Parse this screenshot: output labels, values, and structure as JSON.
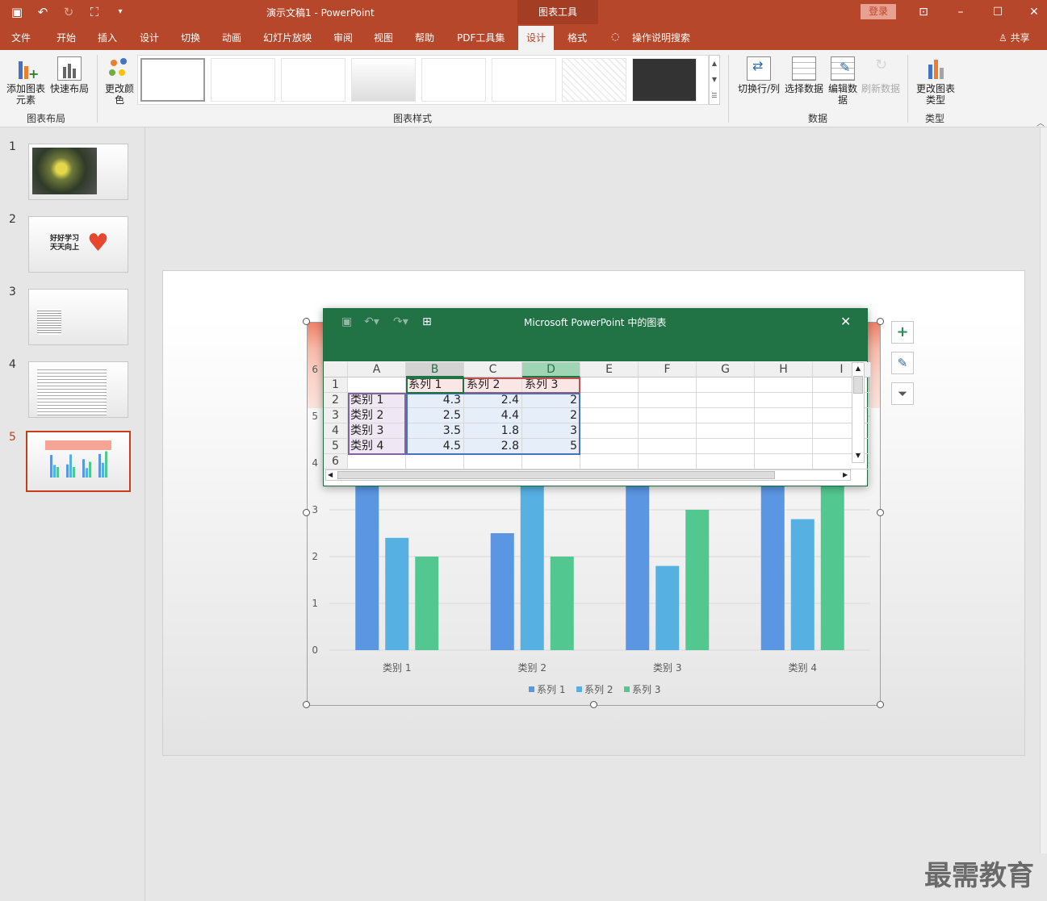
{
  "titlebar": {
    "doc_title": "演示文稿1  -  PowerPoint",
    "tools_tab": "图表工具",
    "login": "登录"
  },
  "tabs": [
    "文件",
    "开始",
    "插入",
    "设计",
    "切换",
    "动画",
    "幻灯片放映",
    "审阅",
    "视图",
    "帮助",
    "PDF工具集",
    "设计",
    "格式",
    "操作说明搜索"
  ],
  "share": "共享",
  "ribbon": {
    "add_element": "添加图表元素",
    "quick_layout": "快速布局",
    "change_color": "更改颜色",
    "group_layout": "图表布局",
    "group_styles": "图表样式",
    "switch_rowcol": "切换行/列",
    "select_data": "选择数据",
    "edit_data": "编辑数据",
    "refresh_data": "刷新数据",
    "group_data": "数据",
    "change_type": "更改图表类型",
    "group_type": "类型"
  },
  "slides": [
    "1",
    "2",
    "3",
    "4",
    "5"
  ],
  "slide2_text": [
    "好好学习",
    "天天向上"
  ],
  "colors": {
    "series1": "#5b96e3",
    "series2": "#56b0e2",
    "series3": "#52c890",
    "accent": "#b7472a"
  },
  "sheet": {
    "title": "Microsoft PowerPoint 中的图表",
    "columns": [
      "A",
      "B",
      "C",
      "D",
      "E",
      "F",
      "G",
      "H",
      "I"
    ],
    "rows": [
      "1",
      "2",
      "3",
      "4",
      "5",
      "6"
    ],
    "header": [
      "",
      "系列 1",
      "系列 2",
      "系列 3"
    ],
    "data": [
      [
        "类别 1",
        "4.3",
        "2.4",
        "2"
      ],
      [
        "类别 2",
        "2.5",
        "4.4",
        "2"
      ],
      [
        "类别 3",
        "3.5",
        "1.8",
        "3"
      ],
      [
        "类别 4",
        "4.5",
        "2.8",
        "5"
      ]
    ]
  },
  "chart_data": {
    "type": "bar",
    "categories": [
      "类别 1",
      "类别 2",
      "类别 3",
      "类别 4"
    ],
    "series": [
      {
        "name": "系列 1",
        "values": [
          4.3,
          2.5,
          3.5,
          4.5
        ]
      },
      {
        "name": "系列 2",
        "values": [
          2.4,
          4.4,
          1.8,
          2.8
        ]
      },
      {
        "name": "系列 3",
        "values": [
          2,
          2,
          3,
          5
        ]
      }
    ],
    "ylim": [
      0,
      6
    ],
    "yticks": [
      "0",
      "1",
      "2",
      "3",
      "4",
      "5",
      "6"
    ],
    "legend": "bottom"
  },
  "watermark": "最需教育"
}
